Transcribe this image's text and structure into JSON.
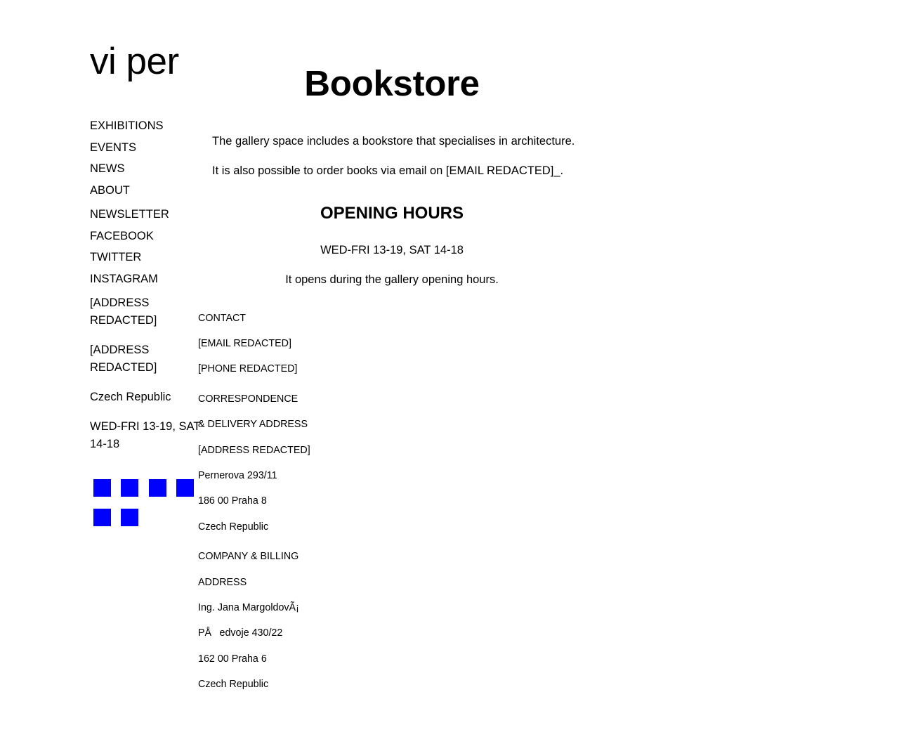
{
  "site": {
    "logo": "vi per"
  },
  "nav": {
    "primary": [
      "EXHIBITIONS",
      "EVENTS",
      "NEWS",
      "ABOUT"
    ],
    "secondary": [
      "NEWSLETTER",
      "FACEBOOK",
      "TWITTER",
      "INSTAGRAM"
    ]
  },
  "sidebar": {
    "address1": "[ADDRESS REDACTED]",
    "address2": "[ADDRESS REDACTED]",
    "country": "Czech Republic",
    "hours": "WED-FRI 13-19, SAT 14-18",
    "icon_color": "#0000ff",
    "icon_count": 6
  },
  "main": {
    "title": "Bookstore",
    "para1": "The gallery space includes a bookstore that specialises in architecture.",
    "para2": "It is also possible to order books via email on [EMAIL REDACTED]_.",
    "opening_heading": "OPENING HOURS",
    "opening_hours": "WED-FRI 13-19, SAT 14-18",
    "opening_note": "It opens during the gallery opening hours."
  },
  "contact": {
    "lines": [
      "CONTACT",
      "[EMAIL REDACTED]",
      "[PHONE REDACTED]",
      "CORRESPONDENCE",
      "& DELIVERY ADDRESS",
      "[ADDRESS REDACTED]",
      "Pernerova 293/11",
      "186 00 Praha 8",
      "Czech Republic",
      "COMPANY & BILLING",
      "ADDRESS",
      "Ing. Jana MargoldovÃ¡",
      "PÅedvoje 430/22",
      "162 00 Praha 6",
      "Czech Republic"
    ]
  }
}
